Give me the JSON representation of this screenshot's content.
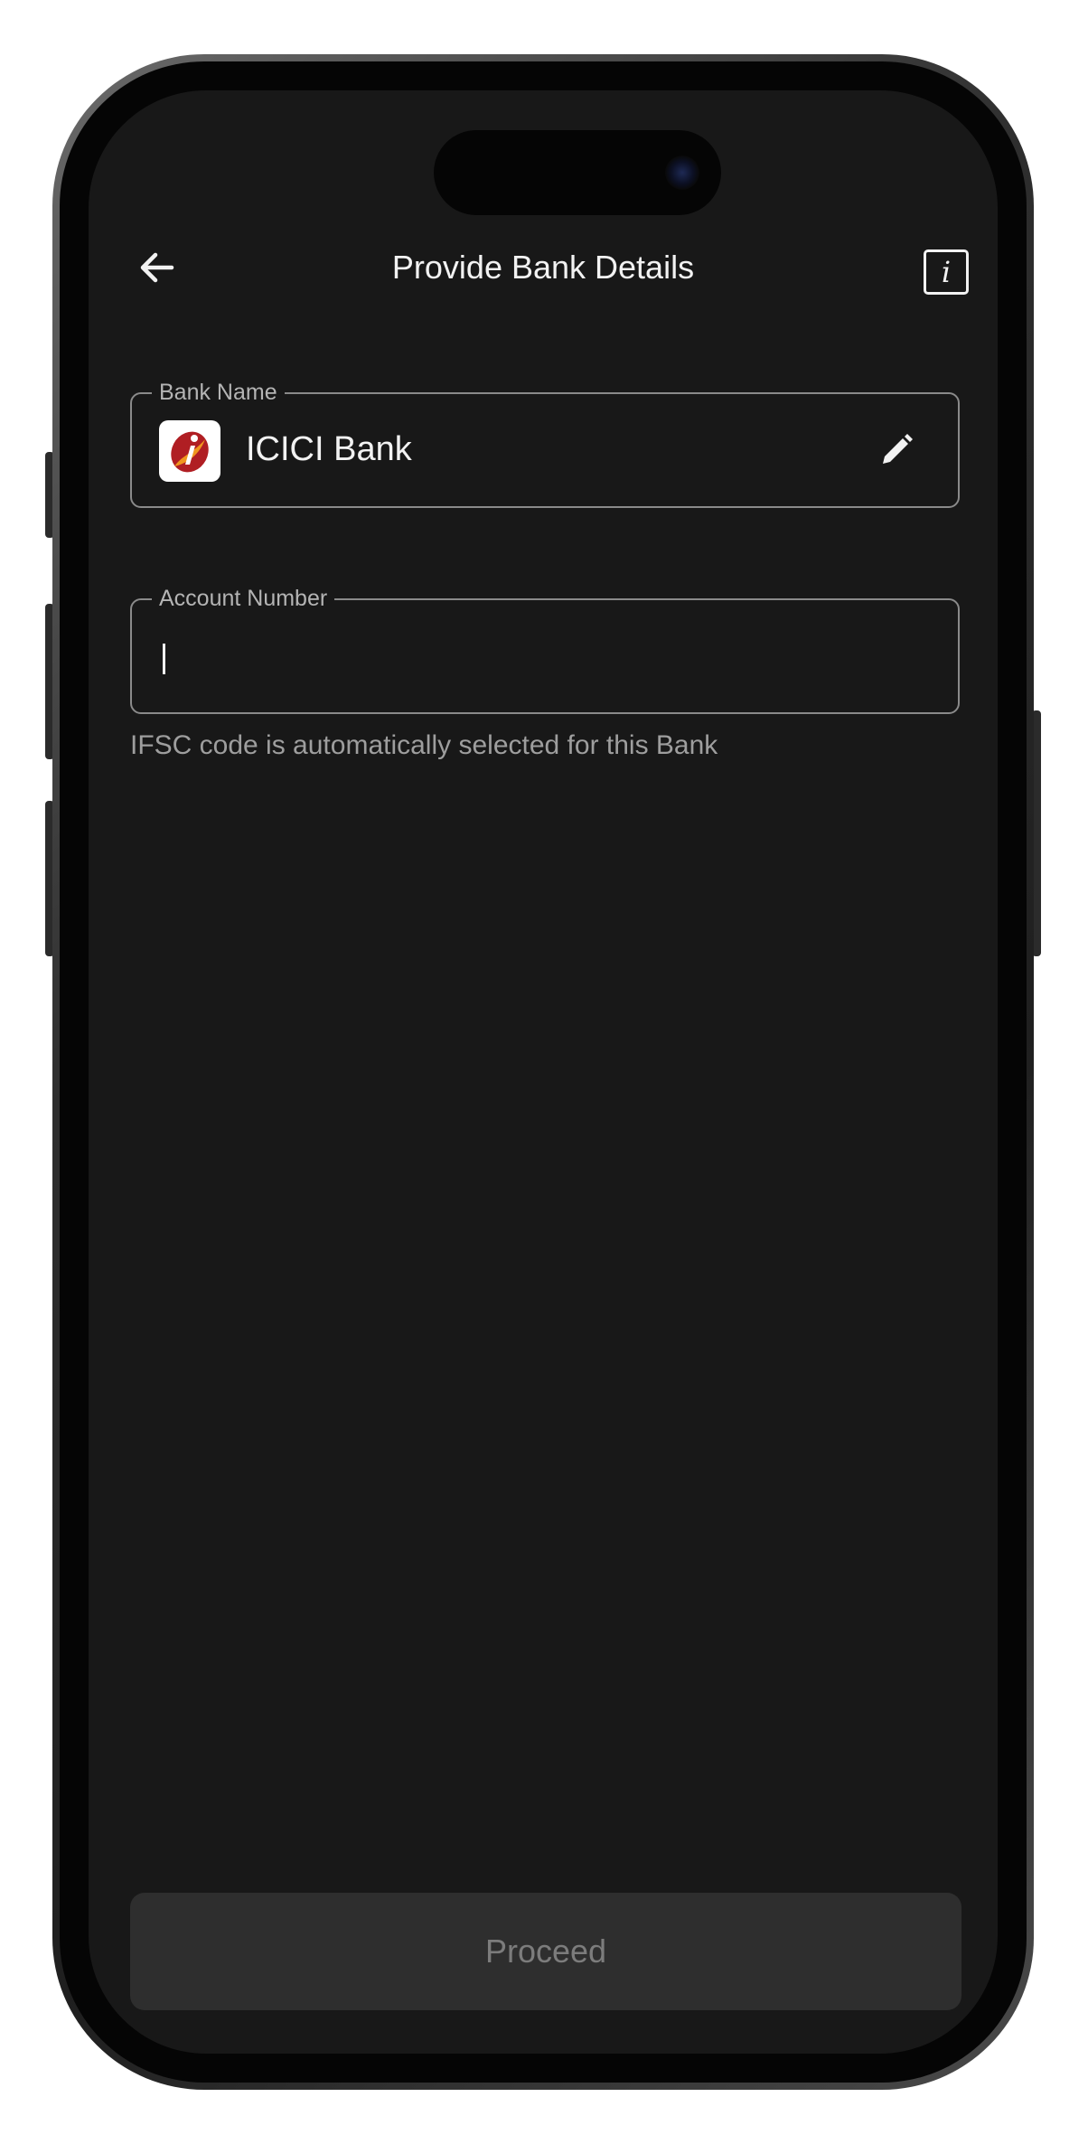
{
  "header": {
    "title": "Provide Bank Details",
    "info_glyph": "i",
    "back_icon": "arrow-left-icon",
    "info_icon": "info-icon"
  },
  "bank_field": {
    "label": "Bank Name",
    "value": "ICICI Bank",
    "logo_icon": "icici-bank-logo",
    "edit_icon": "pencil-icon"
  },
  "account_field": {
    "label": "Account Number",
    "value": "",
    "helper": "IFSC code is automatically selected for this Bank"
  },
  "actions": {
    "proceed_label": "Proceed"
  },
  "colors": {
    "screen_background": "#181818",
    "text_primary": "#f2f2f2",
    "text_secondary": "#9e9e9e",
    "field_border": "#8a8a8a",
    "button_disabled_bg": "#2e2e2e",
    "button_disabled_text": "#7c7c7c",
    "logo_red": "#b01e23",
    "logo_orange": "#f0961e"
  }
}
